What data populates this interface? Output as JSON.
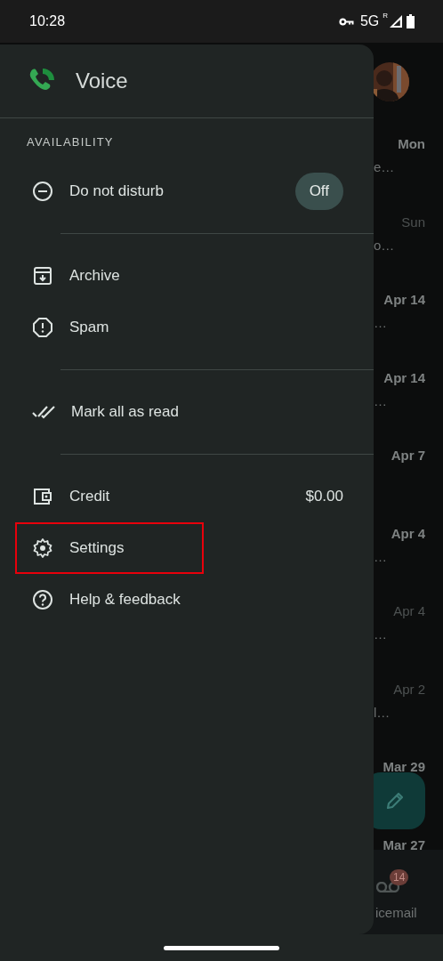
{
  "status_bar": {
    "time": "10:28",
    "network": "5G",
    "roaming": "R"
  },
  "background": {
    "rows": [
      {
        "date": "Mon",
        "unread": true,
        "snippet": "e…"
      },
      {
        "date": "Sun",
        "unread": false,
        "snippet": "o…"
      },
      {
        "date": "Apr 14",
        "unread": true,
        "snippet": "…"
      },
      {
        "date": "Apr 14",
        "unread": true,
        "snippet": "…"
      },
      {
        "date": "Apr 7",
        "unread": true
      },
      {
        "date": "Apr 4",
        "unread": true,
        "snippet": "…"
      },
      {
        "date": "Apr 4",
        "unread": false,
        "snippet": "…"
      },
      {
        "date": "Apr 2",
        "unread": false,
        "snippet": "l…"
      },
      {
        "date": "Mar 29",
        "unread": true
      },
      {
        "date": "Mar 27",
        "unread": true
      }
    ],
    "nav": {
      "badge": "14",
      "label": "icemail"
    }
  },
  "drawer": {
    "title": "Voice",
    "sections": [
      {
        "heading": "AVAILABILITY",
        "items": [
          {
            "label": "Do not disturb",
            "toggle": "Off",
            "highlighted": false
          }
        ]
      },
      {
        "items": [
          {
            "label": "Archive",
            "highlighted": false
          },
          {
            "label": "Spam",
            "highlighted": false
          }
        ]
      },
      {
        "items": [
          {
            "label": "Mark all as read",
            "highlighted": false
          }
        ]
      },
      {
        "items": [
          {
            "label": "Credit",
            "value": "$0.00",
            "highlighted": false
          },
          {
            "label": "Settings",
            "highlighted": true
          },
          {
            "label": "Help & feedback",
            "highlighted": false
          }
        ]
      }
    ]
  }
}
